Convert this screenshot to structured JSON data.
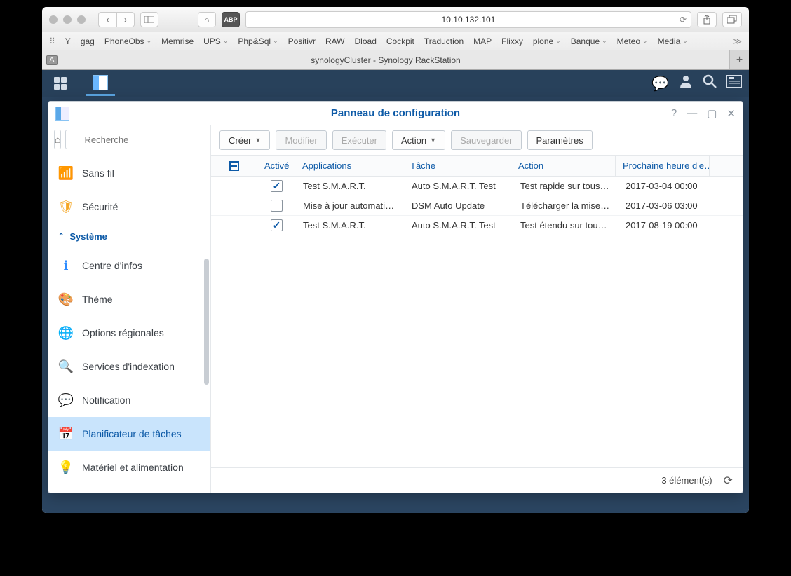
{
  "browser": {
    "url": "10.10.132.101",
    "bookmarks": [
      "Y",
      "gag",
      "PhoneObs",
      "Memrise",
      "UPS",
      "Php&Sql",
      "Positivr",
      "RAW",
      "Dload",
      "Cockpit",
      "Traduction",
      "MAP",
      "Flixxy",
      "plone",
      "Banque",
      "Meteo",
      "Media"
    ],
    "bookmark_chevrons": [
      false,
      false,
      true,
      false,
      true,
      true,
      false,
      false,
      false,
      false,
      false,
      false,
      false,
      true,
      true,
      true,
      true
    ],
    "tab_title": "synologyCluster - Synology RackStation"
  },
  "cp": {
    "title": "Panneau de configuration",
    "search_placeholder": "Recherche",
    "sidebar": {
      "items_top": [
        {
          "icon": "wifi",
          "label": "Sans fil",
          "cls": "ic-wifi"
        },
        {
          "icon": "shield",
          "label": "Sécurité",
          "cls": "ic-shield"
        }
      ],
      "section": "Système",
      "items_sys": [
        {
          "icon": "info",
          "label": "Centre d'infos",
          "cls": "ic-info"
        },
        {
          "icon": "palette",
          "label": "Thème",
          "cls": "ic-theme"
        },
        {
          "icon": "globe",
          "label": "Options régionales",
          "cls": "ic-region"
        },
        {
          "icon": "search",
          "label": "Services d'indexation",
          "cls": "ic-index"
        },
        {
          "icon": "chat",
          "label": "Notification",
          "cls": "ic-notif"
        },
        {
          "icon": "calendar",
          "label": "Planificateur de tâches",
          "cls": "ic-sched",
          "selected": true
        },
        {
          "icon": "bulb",
          "label": "Matériel et alimentation",
          "cls": "ic-hw"
        }
      ]
    },
    "toolbar": {
      "create": "Créer",
      "modify": "Modifier",
      "execute": "Exécuter",
      "action": "Action",
      "save": "Sauvegarder",
      "settings": "Paramètres"
    },
    "columns": {
      "active": "Activé",
      "app": "Applications",
      "task": "Tâche",
      "action": "Action",
      "next": "Prochaine heure d'e…"
    },
    "rows": [
      {
        "checked": true,
        "app": "Test S.M.A.R.T.",
        "task": "Auto S.M.A.R.T. Test",
        "action": "Test rapide sur tous l…",
        "next": "2017-03-04 00:00"
      },
      {
        "checked": false,
        "app": "Mise à jour automatiq…",
        "task": "DSM Auto Update",
        "action": "Télécharger la mise à…",
        "next": "2017-03-06 03:00"
      },
      {
        "checked": true,
        "app": "Test S.M.A.R.T.",
        "task": "Auto S.M.A.R.T. Test",
        "action": "Test étendu sur tous l…",
        "next": "2017-08-19 00:00"
      }
    ],
    "footer_count": "3 élément(s)"
  }
}
